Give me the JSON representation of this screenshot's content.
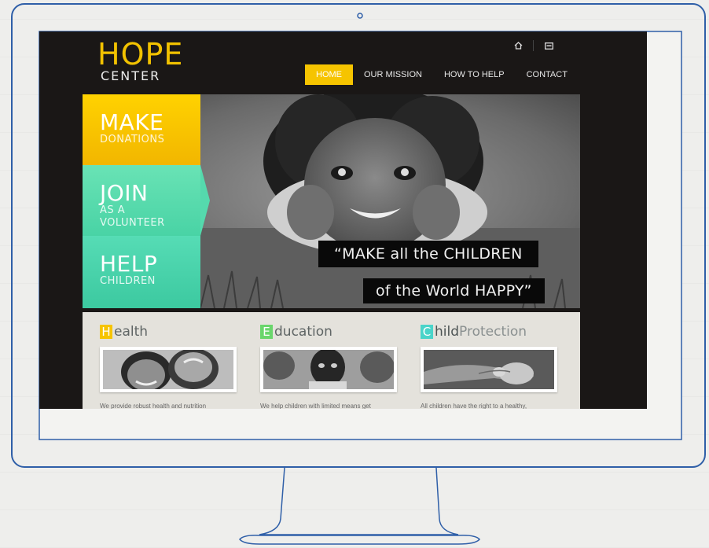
{
  "brand": {
    "line1": "HOPE",
    "line2": "CENTER",
    "accent": "#f6c400"
  },
  "top_icons": [
    "home-icon",
    "mail-icon"
  ],
  "nav": {
    "items": [
      {
        "label": "HOME",
        "active": true
      },
      {
        "label": "OUR MISSION",
        "active": false
      },
      {
        "label": "HOW TO HELP",
        "active": false
      },
      {
        "label": "CONTACT",
        "active": false
      }
    ]
  },
  "tiles": [
    {
      "big": "MAKE",
      "small": [
        "DONATIONS"
      ],
      "color": "#ffd200"
    },
    {
      "big": "JOIN",
      "small": [
        "AS A",
        "VOLUNTEER"
      ],
      "color": "#5fe0b2"
    },
    {
      "big": "HELP",
      "small": [
        "CHILDREN"
      ],
      "color": "#45d0a8"
    }
  ],
  "quote": {
    "line1": "“MAKE all the CHILDREN",
    "line2": "of the World HAPPY”"
  },
  "features": [
    {
      "initial": "H",
      "rest": "ealth",
      "initial_color": "#f6c400",
      "desc": "We provide robust health and nutrition"
    },
    {
      "initial": "E",
      "rest": "ducation",
      "initial_color": "#6ad66c",
      "desc": "We help children with limited means get"
    },
    {
      "initial": "C",
      "rest_bold": "hild",
      "rest_light": "Protection",
      "initial_color": "#4ad4c9",
      "desc": "All children have the right to a healthy,"
    }
  ]
}
